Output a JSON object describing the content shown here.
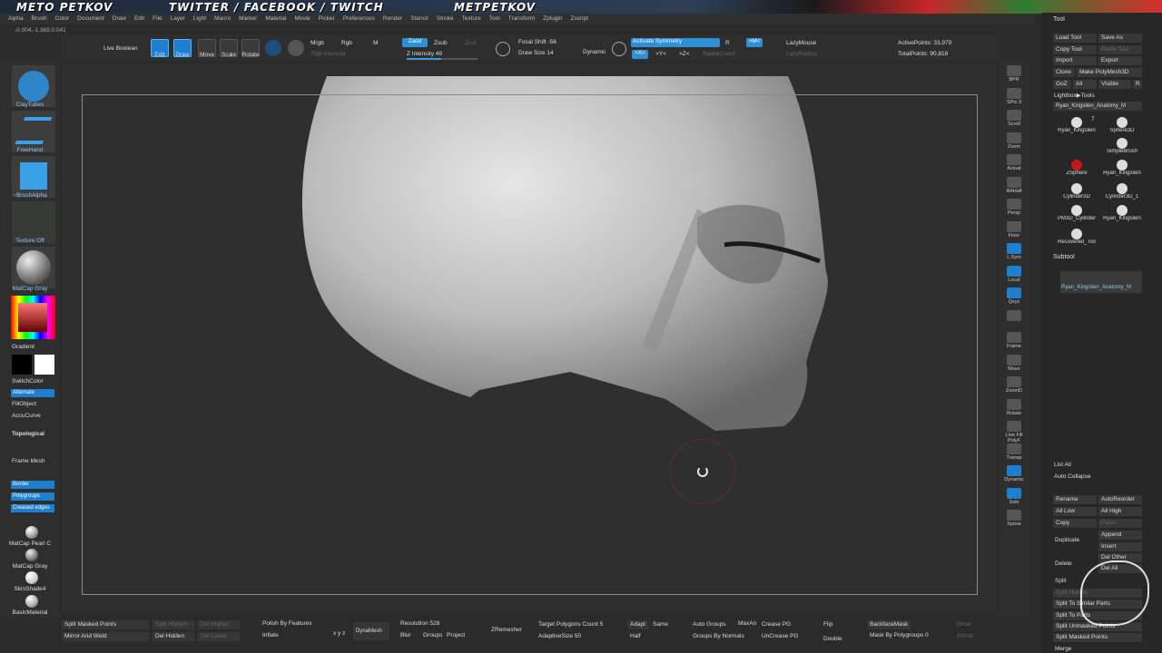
{
  "banner": {
    "name": "METO PETKOV",
    "social": "TWITTER / FACEBOOK / TWITCH",
    "handle": "METPETKOV"
  },
  "menu": [
    "Alpha",
    "Brush",
    "Color",
    "Document",
    "Draw",
    "Edit",
    "File",
    "Layer",
    "Light",
    "Macro",
    "Marker",
    "Material",
    "Movie",
    "Picker",
    "Preferences",
    "Render",
    "Stencil",
    "Stroke",
    "Texture",
    "Tool",
    "Transform",
    "Zplugin",
    "Zscript"
  ],
  "coords": "-0.004,-1.369,0.041",
  "topbar": {
    "live_boolean": "Live Boolean",
    "edit": "Edit",
    "draw": "Draw",
    "move": "Move",
    "scale": "Scale",
    "rotate": "Rotate",
    "mrgb": "Mrgb",
    "rgb": "Rgb",
    "m": "M",
    "rgb_intensity": "Rgb Intensity",
    "zadd": "Zadd",
    "zsub": "Zsub",
    "zcut": "Zcut",
    "z_intensity": "Z Intensity 49",
    "focal_shift": "Focal Shift -56",
    "draw_size": "Draw Size 14",
    "dynamic": "Dynamic",
    "activate_symmetry": "Activate Symmetry",
    "r": "R",
    "mx": ">M<",
    "x": ">X<",
    "y": ">Y<",
    "z": ">Z<",
    "radial_count": "RadialCount",
    "lazymouse": "LazyMouse",
    "lazyradius": "LazyRadius",
    "active_points": "ActivePoints: 33,979",
    "total_points": "TotalPoints: 90,818",
    "z_intensity_fraction": 0.49
  },
  "left": {
    "brush": "ClayTubes",
    "stroke": "FreeHand",
    "alpha": "~BrushAlpha",
    "texture": "Texture Off",
    "material": "MatCap Gray",
    "gradient": "Gradient",
    "switch_color": "SwitchColor",
    "alternate": "Alternate",
    "fill_object": "FillObject",
    "accucurve": "AccuCurve",
    "topological": "Topological",
    "frame_mesh": "Frame Mesh",
    "border": "Border",
    "polygroups": "Polygroups",
    "creased_edges": "Creased edges",
    "mat_pearl": "MatCap Pearl C",
    "mat_gray": "MatCap Gray",
    "skinshade": "SkinShade4",
    "basic": "BasicMaterial"
  },
  "right_tools": [
    "BPR",
    "SPix 3",
    "Scroll",
    "Zoom",
    "Actual",
    "AAHalf",
    "Persp",
    "Floor",
    "L.Sym",
    "Local",
    "Qxyz",
    "",
    "Frame",
    "Move",
    "ZoomD",
    "Rotate",
    "Line Fill PolyF",
    "Transp",
    "Dynamic",
    "Solo",
    "Xpose"
  ],
  "toolpanel": {
    "title": "Tool",
    "load_tool": "Load Tool",
    "save_as": "Save As",
    "copy_tool": "Copy Tool",
    "paste_tool": "Paste Tool",
    "import": "Import",
    "export": "Export",
    "clone": "Clone",
    "make_polymesh": "Make PolyMesh3D",
    "goz": "GoZ",
    "all": "All",
    "visible": "Visible",
    "r": "R",
    "lightbox": "Lightbox▶Tools",
    "current_tool": "Ryan_Kingslien_Anatomy_M",
    "thumbs": [
      "Ryan_Kingslien",
      "Sphere3D",
      "SimpleBrush",
      "ZSphere",
      "Ryan_Kingslien",
      "Cylinder3D",
      "Cylinder3D_1",
      "PM3D_Cylinder",
      "Ryan_Kingslien",
      "Recovered_Too"
    ],
    "thumb_count": "7",
    "subtool": "Subtool",
    "subtool_item": "Ryan_Kingslien_Anatomy_M",
    "list_all": "List All",
    "auto_collapse": "Auto Collapse",
    "rename": "Rename",
    "autoreorder": "AutoReorder",
    "all_low": "All Low",
    "all_high": "All High",
    "copy": "Copy",
    "paste": "Paste",
    "duplicate": "Duplicate",
    "append": "Append",
    "insert": "Insert",
    "delete": "Delete",
    "del_other": "Del Other",
    "del_all": "Del All",
    "split": "Split",
    "split_hidden": "Split Hidden",
    "split_similar": "Split To Similar Parts",
    "split_parts": "Split To Parts",
    "split_unmasked": "Split Unmasked Points",
    "split_masked": "Split Masked Points",
    "merge": "Merge"
  },
  "bottom": {
    "split_masked": "Split Masked Points",
    "split_hidden": "Split Hidden",
    "del_higher": "Del Higher",
    "mirror_weld": "Mirror And Weld",
    "del_hidden": "Del Hidden",
    "del_lower": "Del Lower",
    "polish_features": "Polish By Features",
    "inflate": "Inflate",
    "xyz": "x y z",
    "dynamesh": "DynaMesh",
    "resolution": "Resolution 528",
    "blur": "Blur",
    "groups": "Groups",
    "project": "Project",
    "zremesher": "ZRemesher",
    "target_poly": "Target Polygons Count 5",
    "adaptive_size": "AdaptiveSize 50",
    "adapt": "Adapt",
    "same": "Same",
    "half": "Half",
    "auto_groups": "Auto Groups",
    "groups_normals": "Groups By Normals",
    "maxan": "MaxAn",
    "crease_pg": "Crease PG",
    "uncrease_pg": "UnCrease PG",
    "flip": "Flip",
    "double": "Double",
    "backface_mask": "BackfaceMask",
    "mask_polygroups": "Mask By Polygroups 0",
    "grow": "Grow",
    "shrink": "Shrink"
  },
  "colors": {
    "accent": "#1f7fcf",
    "panel": "#2e2e2e",
    "canvas": "#2f2f2f"
  }
}
